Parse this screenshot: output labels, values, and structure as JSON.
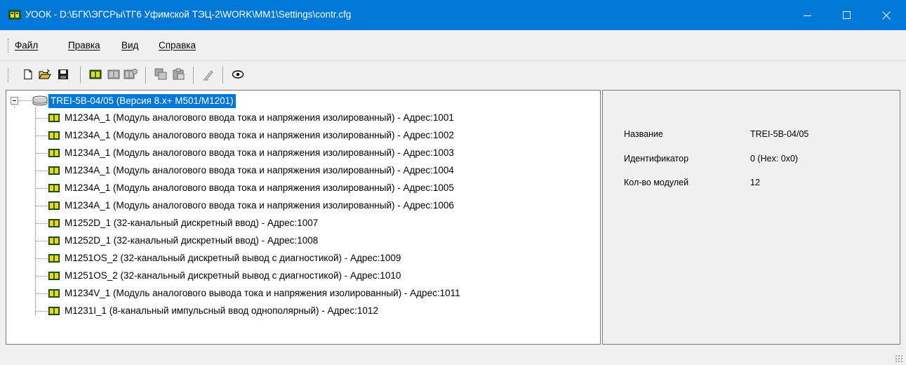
{
  "window": {
    "title": "УООК - D:\\БГК\\ЭГСРы\\ТГ6 Уфимской ТЭЦ-2\\WORK\\MM1\\Settings\\contr.cfg",
    "icon": "module-board-icon",
    "title_bar_color": "#0078d7",
    "buttons": [
      "minimize-icon",
      "maximize-icon",
      "close-icon"
    ]
  },
  "menu": {
    "items": [
      {
        "label": "Файл"
      },
      {
        "label": "Правка"
      },
      {
        "label": "Вид"
      },
      {
        "label": "Справка"
      }
    ]
  },
  "toolbar": {
    "buttons": [
      {
        "icon": "new-file-icon",
        "enabled": true
      },
      {
        "icon": "open-folder-icon",
        "enabled": true
      },
      {
        "icon": "save-disk-icon",
        "enabled": true
      },
      {
        "icon": "add-module-icon",
        "enabled": true
      },
      {
        "icon": "remove-module-icon",
        "enabled": false
      },
      {
        "icon": "module-settings-icon",
        "enabled": false
      },
      {
        "icon": "copy-module-icon",
        "enabled": false
      },
      {
        "icon": "paste-module-icon",
        "enabled": false
      },
      {
        "icon": "edit-pen-icon",
        "enabled": false
      },
      {
        "icon": "view-eye-icon",
        "enabled": true
      }
    ]
  },
  "tree": {
    "root": {
      "label": "TREI-5B-04/05 (Версия 8.x+ M501/M1201)",
      "expanded": true,
      "selected": true,
      "icon": "controller-drive-icon"
    },
    "children": [
      {
        "label": "M1234A_1 (Модуль аналогового ввода тока и напряжения изолированный) - Адрес:1001"
      },
      {
        "label": "M1234A_1 (Модуль аналогового ввода тока и напряжения изолированный) - Адрес:1002"
      },
      {
        "label": "M1234A_1 (Модуль аналогового ввода тока и напряжения изолированный) - Адрес:1003"
      },
      {
        "label": "M1234A_1 (Модуль аналогового ввода тока и напряжения изолированный) - Адрес:1004"
      },
      {
        "label": "M1234A_1 (Модуль аналогового ввода тока и напряжения изолированный) - Адрес:1005"
      },
      {
        "label": "M1234A_1 (Модуль аналогового ввода тока и напряжения изолированный) - Адрес:1006"
      },
      {
        "label": "M1252D_1 (32-канальный дискретный ввод) - Адрес:1007"
      },
      {
        "label": "M1252D_1 (32-канальный дискретный ввод) - Адрес:1008"
      },
      {
        "label": "M1251OS_2 (32-канальный дискретный вывод с диагностикой) - Адрес:1009"
      },
      {
        "label": "M1251OS_2 (32-канальный дискретный вывод с диагностикой) - Адрес:1010"
      },
      {
        "label": "M1234V_1 (Модуль аналогового вывода тока и напряжения изолированный) - Адрес:1011"
      },
      {
        "label": "M1231I_1 (8-канальный импульсный ввод однополярный) - Адрес:1012"
      }
    ]
  },
  "properties": [
    {
      "key": "Название",
      "value": "TREI-5B-04/05"
    },
    {
      "key": "Идентификатор",
      "value": "0 (Hex: 0x0)"
    },
    {
      "key": "Кол-во модулей",
      "value": "12"
    }
  ]
}
